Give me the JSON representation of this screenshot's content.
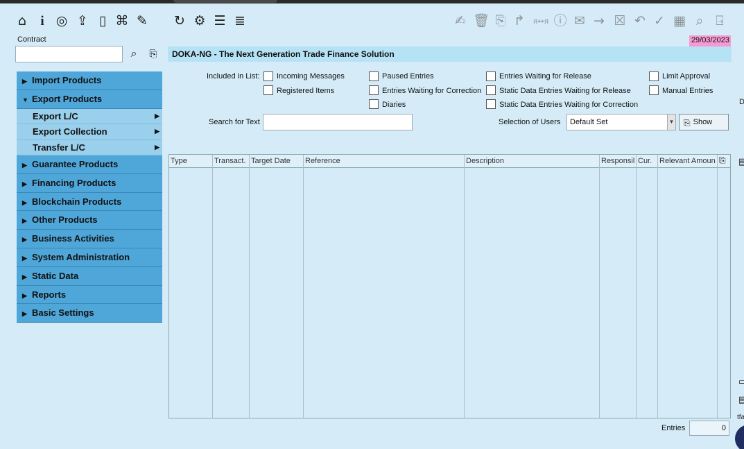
{
  "toolbar": {
    "left_icons": [
      "home-icon",
      "info-icon",
      "target-icon",
      "exit-icon",
      "book-icon",
      "network-icon",
      "edit-icon",
      "refresh-icon",
      "settings-icon",
      "checklist-icon",
      "list-icon"
    ],
    "right_icons": [
      "sign-icon",
      "delete-icon",
      "attach-icon",
      "forward-icon",
      "translate-icon",
      "info-box-icon",
      "mail-icon",
      "arrow-right-icon",
      "close-box-icon",
      "undo-icon",
      "check-icon",
      "calendar-icon",
      "search-icon",
      "exit-door-icon"
    ]
  },
  "contract": {
    "label": "Contract",
    "value": ""
  },
  "date": "29/03/2023",
  "title": "DOKA-NG - The Next Generation Trade Finance Solution",
  "menu": {
    "items": [
      {
        "label": "Import Products",
        "open": false
      },
      {
        "label": "Export Products",
        "open": true
      },
      {
        "label": "Export L/C",
        "sub": true
      },
      {
        "label": "Export Collection",
        "sub": true
      },
      {
        "label": "Transfer L/C",
        "sub": true
      },
      {
        "label": "Guarantee Products",
        "open": false
      },
      {
        "label": "Financing Products",
        "open": false
      },
      {
        "label": "Blockchain Products",
        "open": false
      },
      {
        "label": "Other Products",
        "open": false
      },
      {
        "label": "Business Activities",
        "open": false
      },
      {
        "label": "System Administration",
        "open": false
      },
      {
        "label": "Static Data",
        "open": false
      },
      {
        "label": "Reports",
        "open": false
      },
      {
        "label": "Basic Settings",
        "open": false
      }
    ]
  },
  "filters": {
    "included_label": "Included in List:",
    "incoming": "Incoming Messages",
    "paused": "Paused Entries",
    "waiting_release": "Entries Waiting for Release",
    "limit": "Limit Approval",
    "registered": "Registered Items",
    "waiting_correction": "Entries Waiting for Correction",
    "static_release": "Static Data Entries Waiting for Release",
    "manual": "Manual Entries",
    "diaries": "Diaries",
    "static_correction": "Static Data Entries Waiting for Correction"
  },
  "search": {
    "label": "Search for Text",
    "value": ""
  },
  "users": {
    "label": "Selection of Users",
    "value": "Default Set"
  },
  "show_label": "Show",
  "grid": {
    "columns": [
      "Type",
      "Transact.",
      "Target Date",
      "Reference",
      "Description",
      "Responsil",
      "Cur.",
      "Relevant Amoun"
    ]
  },
  "entries": {
    "label": "Entries",
    "value": "0"
  },
  "right_edge": {
    "d": "D",
    "tf": "tfa"
  }
}
